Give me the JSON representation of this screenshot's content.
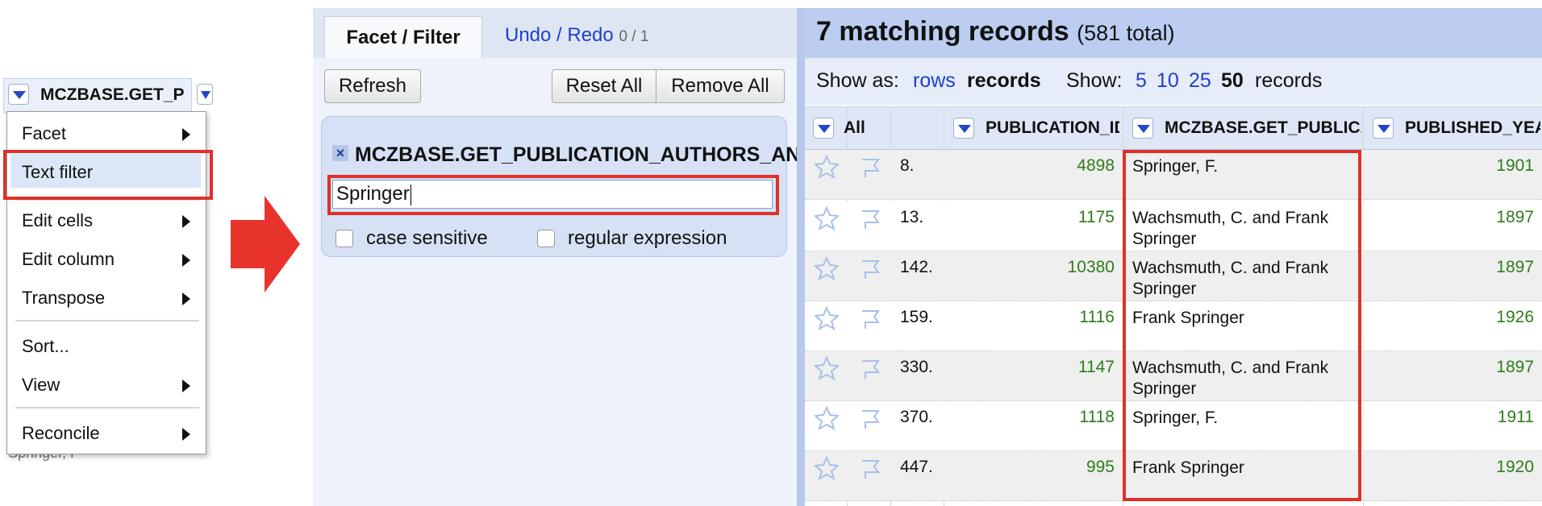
{
  "column_menu": {
    "column_title": "MCZBASE.GET_P",
    "items": [
      {
        "label": "Facet",
        "has_submenu": true
      },
      {
        "label": "Text filter",
        "has_submenu": false,
        "highlighted": true
      },
      {
        "label": "Edit cells",
        "has_submenu": true
      },
      {
        "label": "Edit column",
        "has_submenu": true
      },
      {
        "label": "Transpose",
        "has_submenu": true
      },
      {
        "label": "Sort...",
        "has_submenu": false
      },
      {
        "label": "View",
        "has_submenu": true
      },
      {
        "label": "Reconcile",
        "has_submenu": true
      }
    ],
    "background_text": "Springer, F"
  },
  "facet_panel": {
    "tabs": {
      "active": "Facet / Filter",
      "undo_label": "Undo / Redo",
      "undo_count": "0 / 1"
    },
    "buttons": {
      "refresh": "Refresh",
      "reset_all": "Reset All",
      "remove_all": "Remove All"
    },
    "facet": {
      "title": "MCZBASE.GET_PUBLICATION_AUTHORS_AND_EDITORS",
      "filter_value": "Springer",
      "case_sensitive_label": "case sensitive",
      "regex_label": "regular expression"
    }
  },
  "records": {
    "count_label": "7 matching records",
    "total_label": "(581 total)",
    "show_as_label": "Show as:",
    "show_as_rows": "rows",
    "show_as_records": "records",
    "show_label": "Show:",
    "page_sizes": [
      "5",
      "10",
      "25",
      "50"
    ],
    "page_size_selected": "50",
    "page_size_suffix": "records",
    "columns": [
      "All",
      "PUBLICATION_ID",
      "MCZBASE.GET_PUBLICATION_AUTHORS",
      "PUBLISHED_YEAR"
    ],
    "rows": [
      {
        "index": "8.",
        "publication_id": "4898",
        "authors": "Springer, F.",
        "year": "1901"
      },
      {
        "index": "13.",
        "publication_id": "1175",
        "authors": "Wachsmuth, C. and Frank Springer",
        "year": "1897"
      },
      {
        "index": "142.",
        "publication_id": "10380",
        "authors": "Wachsmuth, C. and Frank Springer",
        "year": "1897"
      },
      {
        "index": "159.",
        "publication_id": "1116",
        "authors": "Frank Springer",
        "year": "1926"
      },
      {
        "index": "330.",
        "publication_id": "1147",
        "authors": "Wachsmuth, C. and Frank Springer",
        "year": "1897"
      },
      {
        "index": "370.",
        "publication_id": "1118",
        "authors": "Springer, F.",
        "year": "1911"
      },
      {
        "index": "447.",
        "publication_id": "995",
        "authors": "Frank Springer",
        "year": "1920"
      }
    ]
  },
  "colors": {
    "highlight_box": "#e0302a",
    "link": "#1f3fd0",
    "numeric_text": "#2e7d1a",
    "header_band": "#bccdf1"
  }
}
